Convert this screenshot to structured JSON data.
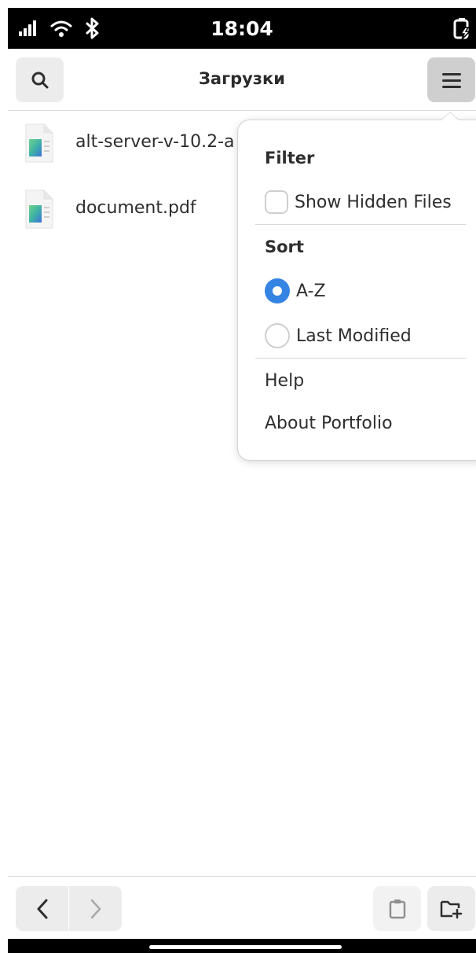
{
  "status_bar": {
    "time": "18:04",
    "icons": [
      "signal-icon",
      "wifi-icon",
      "bluetooth-icon",
      "battery-charging-icon"
    ]
  },
  "header": {
    "title": "Загрузки",
    "search_icon": "search-icon",
    "menu_icon": "hamburger-menu-icon"
  },
  "files": [
    {
      "name": "alt-server-v-10.2-a",
      "icon": "file-icon"
    },
    {
      "name": "document.pdf",
      "icon": "file-icon"
    }
  ],
  "menu": {
    "filter_heading": "Filter",
    "show_hidden_label": "Show Hidden Files",
    "show_hidden_checked": false,
    "sort_heading": "Sort",
    "sort_options": [
      {
        "label": "A-Z",
        "selected": true
      },
      {
        "label": "Last Modified",
        "selected": false
      }
    ],
    "help_label": "Help",
    "about_label": "About Portfolio"
  },
  "bottom_bar": {
    "back_icon": "chevron-left-icon",
    "forward_icon": "chevron-right-icon",
    "clipboard_icon": "clipboard-icon",
    "new_folder_icon": "folder-new-icon"
  },
  "colors": {
    "accent": "#3584e4",
    "button_bg": "#ececec",
    "menu_button_bg": "#cfcfcf"
  }
}
